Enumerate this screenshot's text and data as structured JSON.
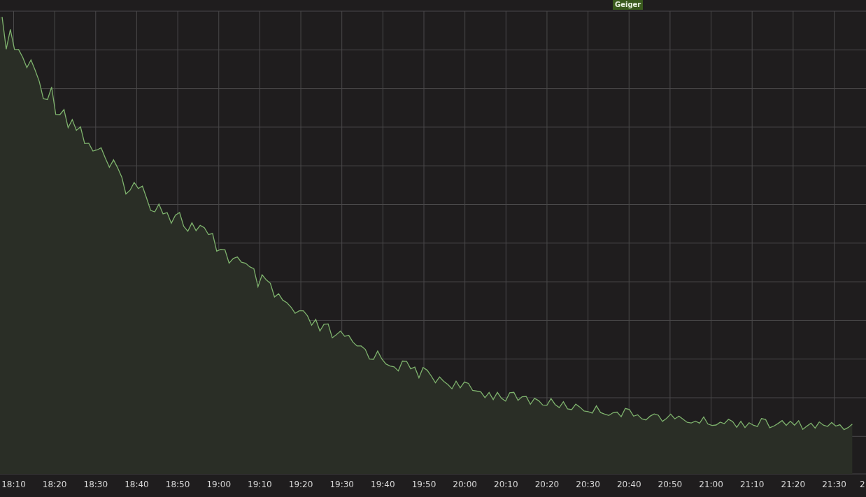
{
  "series_label": {
    "text": "Geiger"
  },
  "x_axis": {
    "ticks": [
      "18:10",
      "18:20",
      "18:30",
      "18:40",
      "18:50",
      "19:00",
      "19:10",
      "19:20",
      "19:30",
      "19:40",
      "19:50",
      "20:00",
      "20:10",
      "20:20",
      "20:30",
      "20:40",
      "20:50",
      "21:00",
      "21:10",
      "21:20",
      "21:30",
      "2"
    ]
  }
}
